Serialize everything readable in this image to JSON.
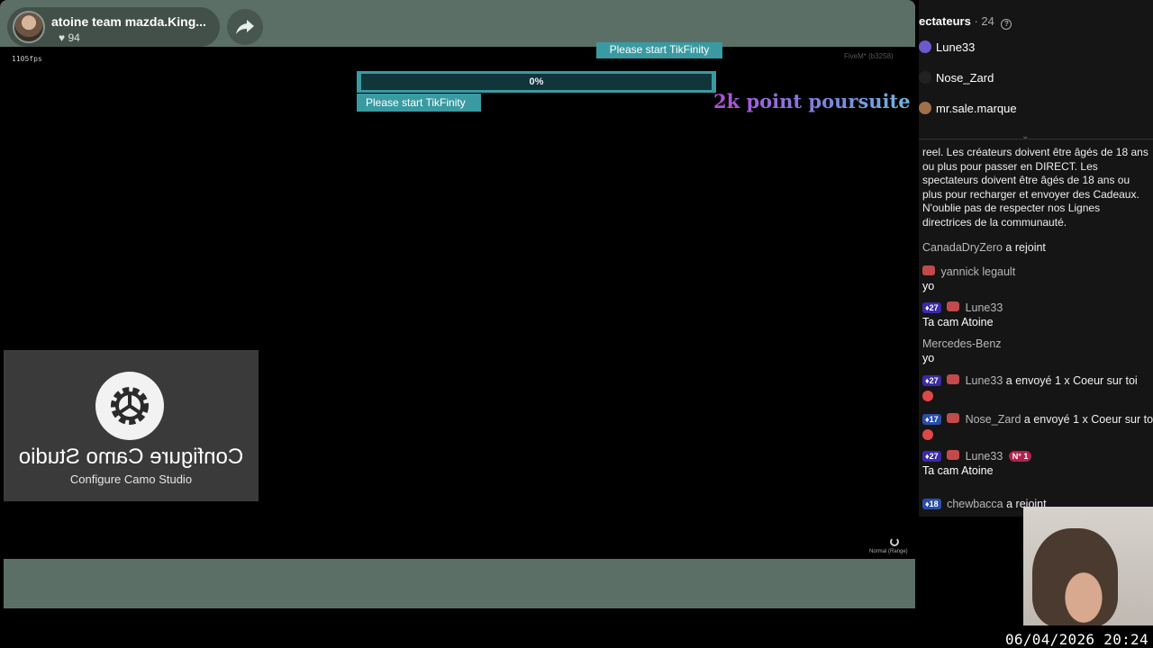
{
  "host": {
    "name": "atoine team mazda.King...",
    "likes": "94"
  },
  "stream": {
    "fps": "1105fps",
    "version": "FiveM* (b3258)",
    "mode": "Normal (Range)"
  },
  "overlay": {
    "tikfinity_top": "Please start TikFinity",
    "progress_label": "0%",
    "progress_fraction": 0,
    "tikfinity_bottom": "Please start TikFinity",
    "goal_title": "2k point poursuite"
  },
  "camo": {
    "mirrored_title": "Configure Camo Studio",
    "subtitle": "Configure Camo Studio"
  },
  "viewers": {
    "title": "ectateurs",
    "count": "· 24",
    "list": [
      {
        "name": "Lune33",
        "color": "#6a5acd"
      },
      {
        "name": "Nose_Zard",
        "color": "#222"
      },
      {
        "name": "mr.sale.marque",
        "color": "#a0704a"
      }
    ]
  },
  "chat": {
    "rules": "reel. Les créateurs doivent être âgés de 18 ans ou plus pour passer en DIRECT. Les spectateurs doivent être âgés de 18 ans ou plus pour recharger et envoyer des Cadeaux. N'oublie pas de respecter nos Lignes directrices de la communauté.",
    "messages": [
      {
        "user": "CanadaDryZero",
        "action": "a rejoint"
      },
      {
        "user": "yannick legault",
        "text": "yo"
      },
      {
        "level": "27",
        "user": "Lune33",
        "text": "Ta cam Atoine"
      },
      {
        "user": "Mercedes-Benz",
        "text": "yo"
      },
      {
        "level": "27",
        "user": "Lune33",
        "action": "a envoyé 1 x Coeur sur toi"
      },
      {
        "level": "17",
        "user": "Nose_Zard",
        "action": "a envoyé 1 x Coeur sur toi"
      },
      {
        "level": "27",
        "user": "Lune33",
        "rank": "N° 1",
        "text": "Ta cam Atoine"
      },
      {
        "level": "18",
        "user": "chewbacca",
        "action": "a rejoint"
      }
    ]
  },
  "timestamp": "06/04/2026  20:24"
}
